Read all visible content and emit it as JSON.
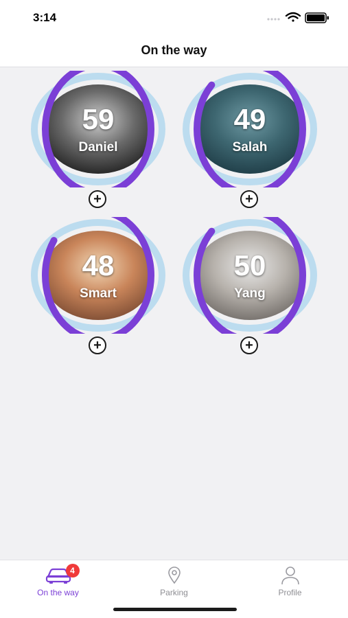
{
  "status": {
    "time": "3:14"
  },
  "header": {
    "title": "On the way"
  },
  "colors": {
    "accent": "#7b3fd6",
    "track": "#bcdcef",
    "badge": "#f03a3a"
  },
  "children": [
    {
      "count": "59",
      "name": "Daniel",
      "progress": 1.0,
      "photo": "bw"
    },
    {
      "count": "49",
      "name": "Salah",
      "progress": 0.88,
      "photo": "teal"
    },
    {
      "count": "48",
      "name": "Smart",
      "progress": 0.85,
      "photo": "warm"
    },
    {
      "count": "50",
      "name": "Yang",
      "progress": 0.88,
      "photo": "grey"
    }
  ],
  "add_symbol": "+",
  "tabbar": {
    "tabs": [
      {
        "label": "On the way",
        "icon": "car-icon",
        "badge": "4",
        "active": true
      },
      {
        "label": "Parking",
        "icon": "location-pin-icon",
        "active": false
      },
      {
        "label": "Profile",
        "icon": "person-icon",
        "active": false
      }
    ]
  }
}
